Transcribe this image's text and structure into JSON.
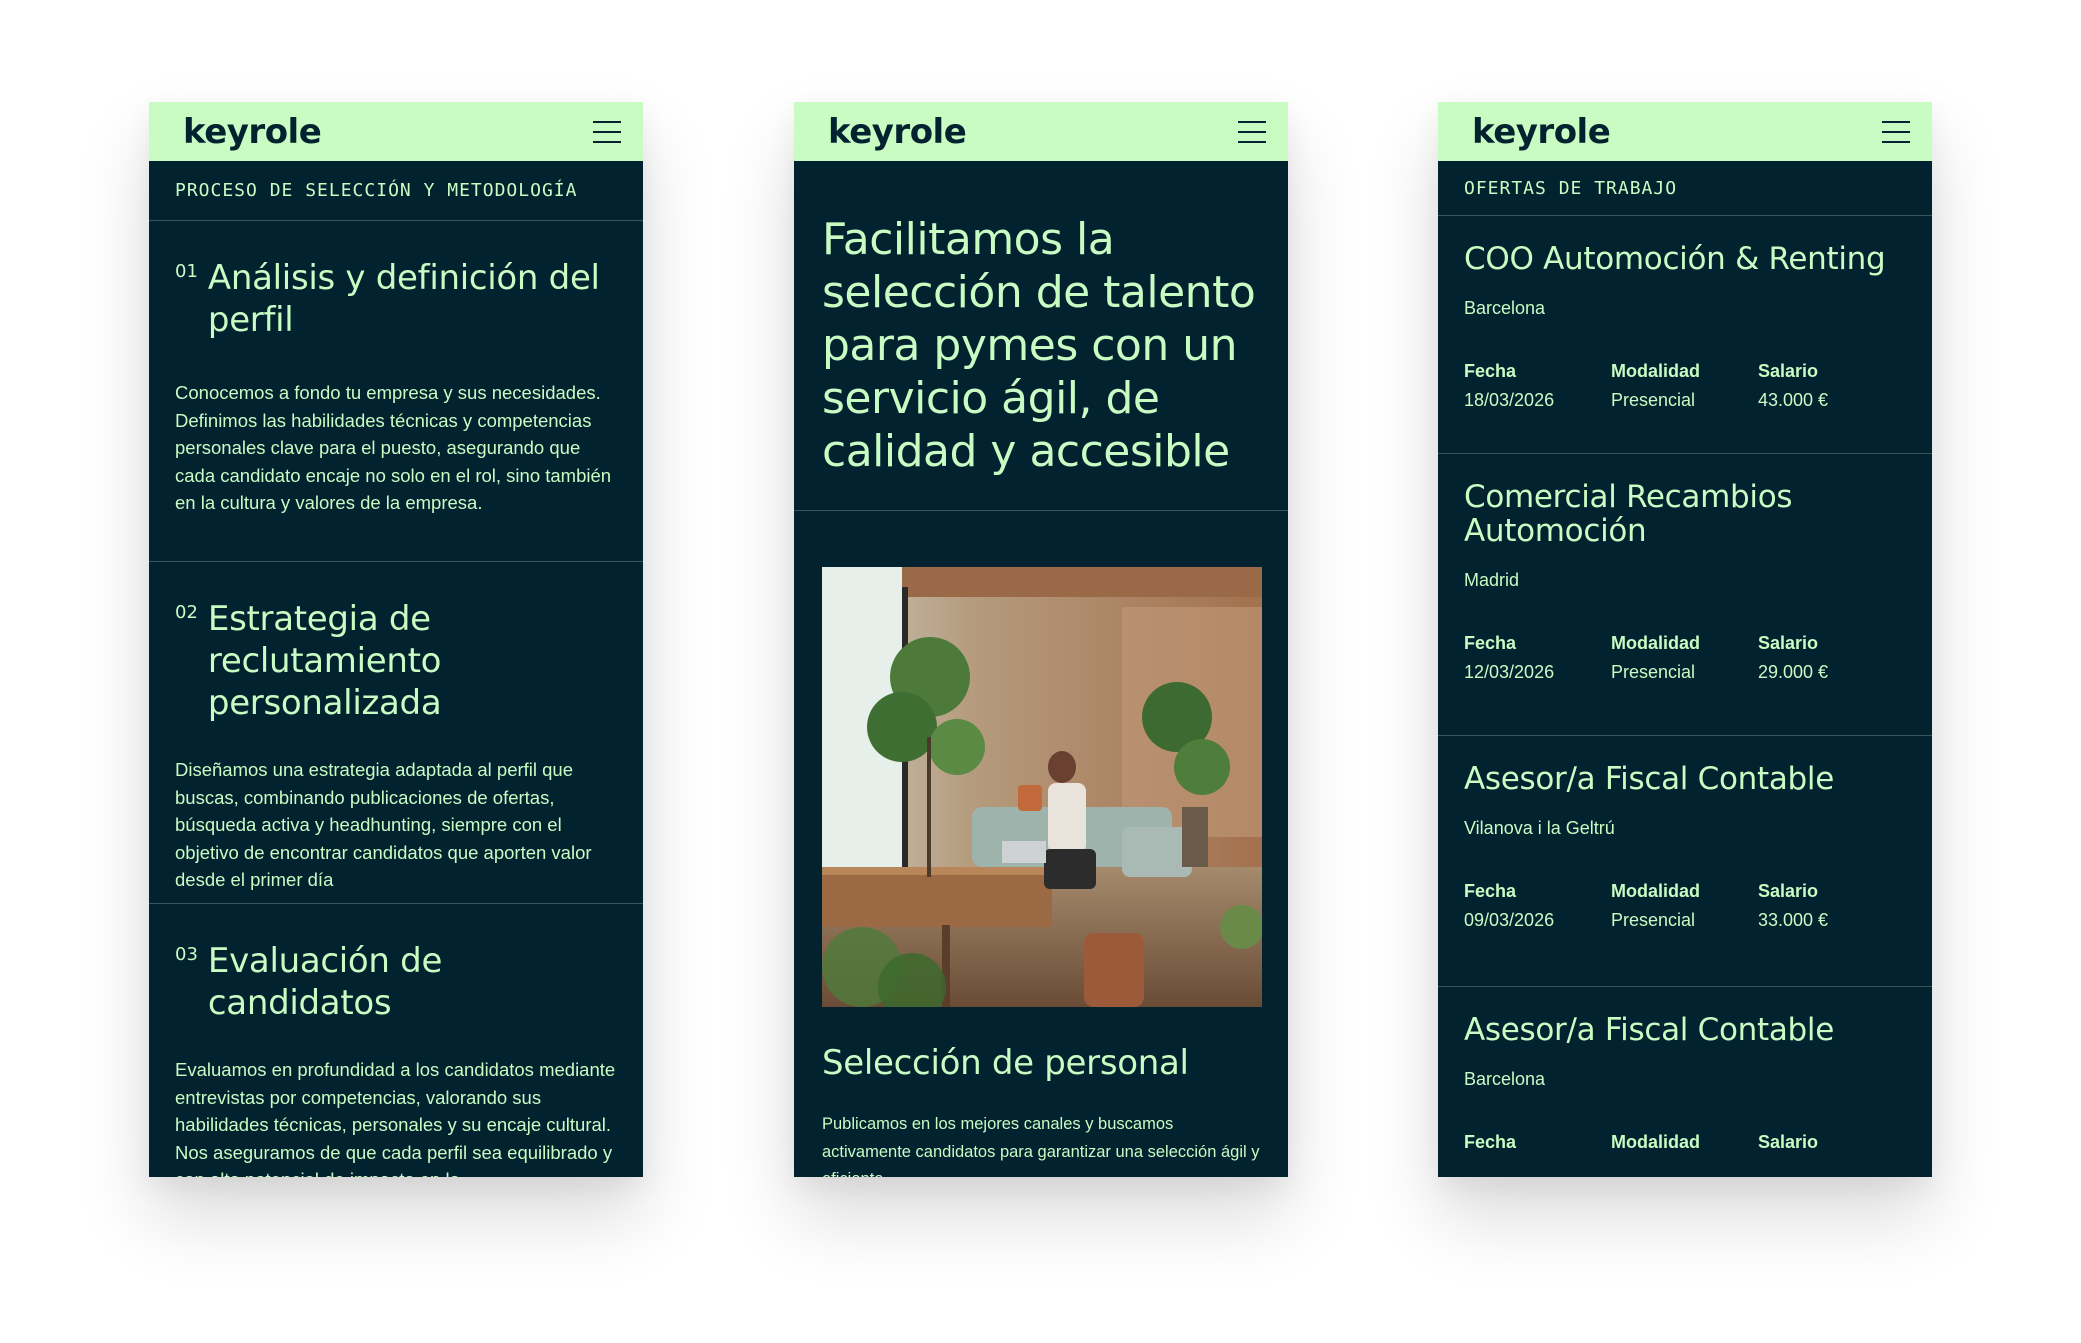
{
  "brand": {
    "logo": "keyrole",
    "bg": "#ffffff",
    "accent": "#c8fcc3",
    "dark": "#01222e"
  },
  "phone1": {
    "section_label": "PROCESO DE SELECCIÓN Y METODOLOGÍA",
    "steps": [
      {
        "num": "01",
        "title": "Análisis y definición del perfil",
        "text": "Conocemos a fondo tu empresa y sus necesidades. Definimos las habilidades técnicas y competencias personales clave para el puesto, asegurando que cada candidato encaje no solo en el rol, sino también en la cultura y valores de la empresa."
      },
      {
        "num": "02",
        "title": "Estrategia de reclutamiento personalizada",
        "text": "Diseñamos una estrategia adaptada al perfil que buscas, combinando publicaciones de ofertas, búsqueda activa y headhunting, siempre con el objetivo de encontrar candidatos que aporten valor desde el primer día"
      },
      {
        "num": "03",
        "title": "Evaluación de candidatos",
        "text": "Evaluamos en profundidad a los candidatos mediante entrevistas por competencias, valorando sus habilidades técnicas, personales y su encaje cultural. Nos aseguramos de que cada perfil sea equilibrado y con alto potencial de impacto en la"
      }
    ]
  },
  "phone2": {
    "hero_title": "Facilitamos la selección de talento para pymes con un servicio ágil, de calidad y accesible",
    "service_title": "Selección de personal",
    "service_text": "Publicamos en los mejores canales  y buscamos activamente candidatos para garantizar una selección ágil y eficiente"
  },
  "phone3": {
    "section_label": "OFERTAS DE TRABAJO",
    "labels": {
      "date": "Fecha",
      "mode": "Modalidad",
      "salary": "Salario"
    },
    "jobs": [
      {
        "title": "COO Automoción & Renting",
        "city": "Barcelona",
        "date": "18/03/2026",
        "mode": "Presencial",
        "salary": "43.000 €"
      },
      {
        "title": "Comercial Recambios Automoción",
        "city": "Madrid",
        "date": "12/03/2026",
        "mode": "Presencial",
        "salary": "29.000 €"
      },
      {
        "title": "Asesor/a Fiscal Contable",
        "city": "Vilanova i la Geltrú",
        "date": "09/03/2026",
        "mode": "Presencial",
        "salary": "33.000 €"
      },
      {
        "title": "Asesor/a Fiscal Contable",
        "city": "Barcelona",
        "date": "",
        "mode": "",
        "salary": ""
      }
    ]
  }
}
